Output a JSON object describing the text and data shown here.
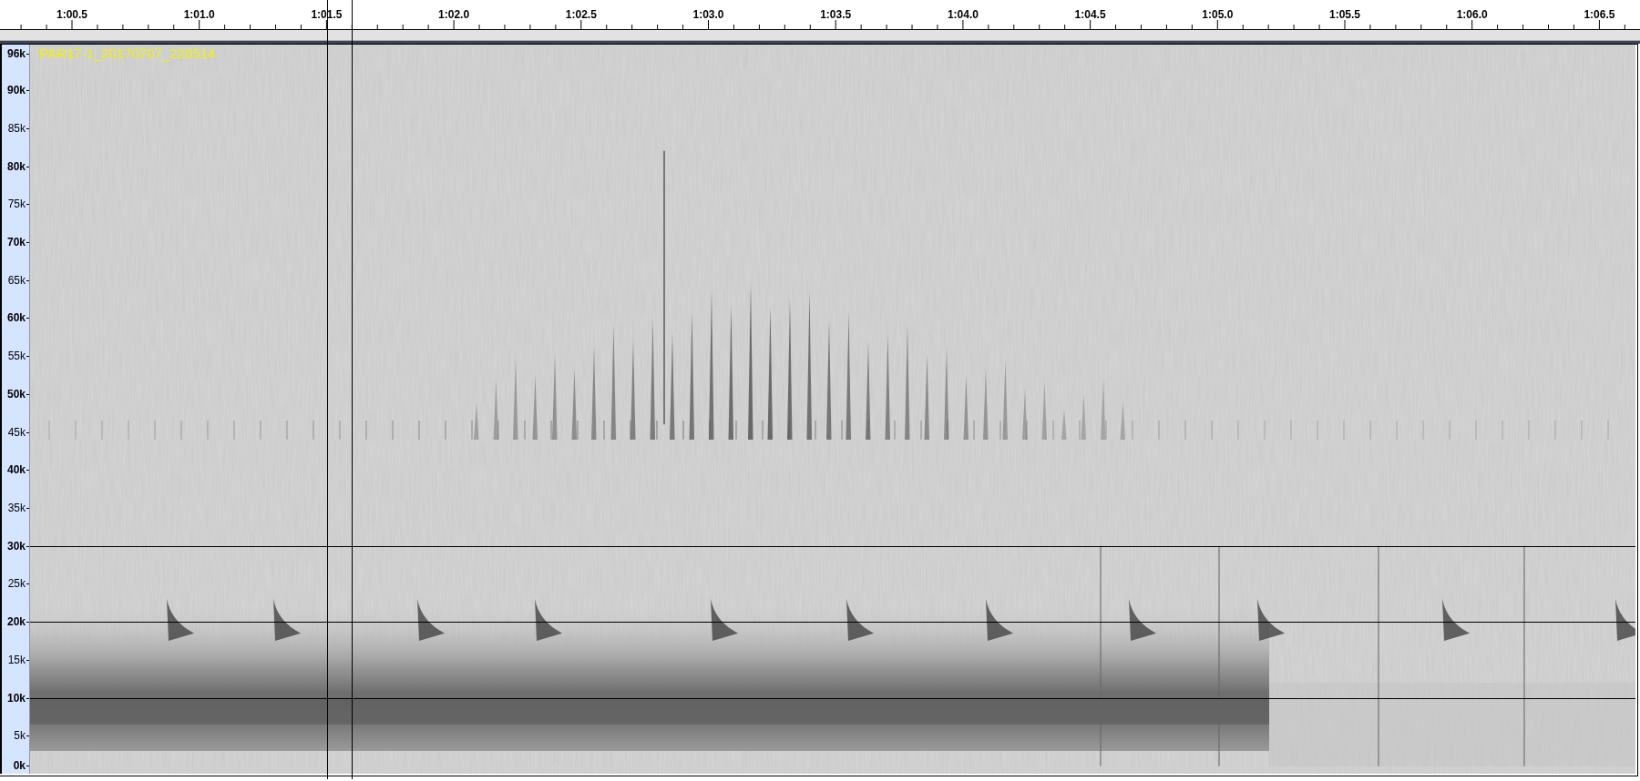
{
  "ruler": {
    "labels": [
      "1:00.5",
      "1:01.0",
      "1:01.5",
      "1:02.0",
      "1:02.5",
      "1:03.0",
      "1:03.5",
      "1:04.0",
      "1:04.5",
      "1:05.0",
      "1:05.5",
      "1:06.0",
      "1:06.5"
    ]
  },
  "track": {
    "name": "PAR17-1_20170707_220514",
    "frequency_labels": [
      {
        "label": "96k",
        "kind": "major"
      },
      {
        "label": "90k",
        "kind": "major"
      },
      {
        "label": "85k",
        "kind": "minor"
      },
      {
        "label": "80k",
        "kind": "major"
      },
      {
        "label": "75k",
        "kind": "minor"
      },
      {
        "label": "70k",
        "kind": "major"
      },
      {
        "label": "65k",
        "kind": "minor"
      },
      {
        "label": "60k",
        "kind": "major"
      },
      {
        "label": "55k",
        "kind": "minor"
      },
      {
        "label": "50k",
        "kind": "major"
      },
      {
        "label": "45k",
        "kind": "minor"
      },
      {
        "label": "40k",
        "kind": "major"
      },
      {
        "label": "35k",
        "kind": "minor"
      },
      {
        "label": "30k",
        "kind": "major"
      },
      {
        "label": "25k",
        "kind": "minor"
      },
      {
        "label": "20k",
        "kind": "major"
      },
      {
        "label": "15k",
        "kind": "minor"
      },
      {
        "label": "10k",
        "kind": "major"
      },
      {
        "label": "5k",
        "kind": "minor"
      },
      {
        "label": "0k",
        "kind": "major"
      }
    ]
  }
}
